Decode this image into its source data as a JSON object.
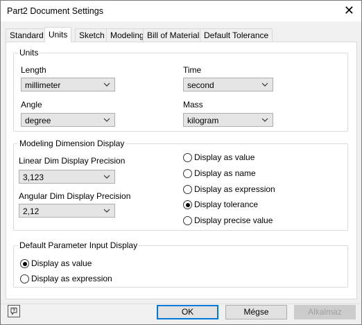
{
  "window": {
    "title": "Part2 Document Settings",
    "close_glyph": "✕"
  },
  "tabs": [
    {
      "label": "Standard",
      "active": false
    },
    {
      "label": "Units",
      "active": true
    },
    {
      "label": "Sketch",
      "active": false
    },
    {
      "label": "Modeling",
      "active": false
    },
    {
      "label": "Bill of Materials",
      "active": false
    },
    {
      "label": "Default Tolerance",
      "active": false
    }
  ],
  "units_group": {
    "title": "Units",
    "length": {
      "label": "Length",
      "value": "millimeter"
    },
    "time": {
      "label": "Time",
      "value": "second"
    },
    "angle": {
      "label": "Angle",
      "value": "degree"
    },
    "mass": {
      "label": "Mass",
      "value": "kilogram"
    }
  },
  "modeling_group": {
    "title": "Modeling Dimension Display",
    "linear": {
      "label": "Linear Dim Display Precision",
      "value": "3,123"
    },
    "angular": {
      "label": "Angular Dim Display Precision",
      "value": "2,12"
    },
    "options": [
      {
        "label": "Display as value",
        "checked": false
      },
      {
        "label": "Display as name",
        "checked": false
      },
      {
        "label": "Display as expression",
        "checked": false
      },
      {
        "label": "Display tolerance",
        "checked": true
      },
      {
        "label": "Display precise value",
        "checked": false
      }
    ]
  },
  "param_group": {
    "title": "Default Parameter Input Display",
    "options": [
      {
        "label": "Display as value",
        "checked": true
      },
      {
        "label": "Display as expression",
        "checked": false
      }
    ]
  },
  "footer": {
    "help_glyph": "?",
    "ok_label": "OK",
    "cancel_label": "Mégse",
    "apply_label": "Alkalmaz"
  },
  "colors": {
    "accent": "#0078d7",
    "disabled_text": "#a0a0a0"
  }
}
